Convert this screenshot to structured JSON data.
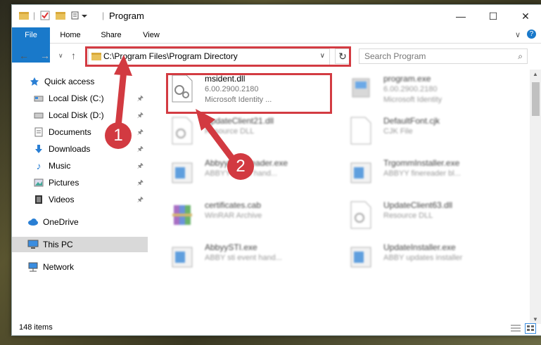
{
  "window": {
    "title": "Program"
  },
  "ribbon": {
    "tabs": [
      "File",
      "Home",
      "Share",
      "View"
    ]
  },
  "address": {
    "path": "C:\\Program Files\\Program Directory"
  },
  "search": {
    "placeholder": "Search Program"
  },
  "sidebar": {
    "items": [
      {
        "label": "Quick access",
        "icon": "star-icon"
      },
      {
        "label": "Local Disk (C:)",
        "icon": "drive-icon",
        "pinned": true
      },
      {
        "label": "Local Disk (D:)",
        "icon": "drive-icon",
        "pinned": true
      },
      {
        "label": "Documents",
        "icon": "documents-icon",
        "pinned": true
      },
      {
        "label": "Downloads",
        "icon": "download-icon",
        "pinned": true
      },
      {
        "label": "Music",
        "icon": "music-icon",
        "pinned": true
      },
      {
        "label": "Pictures",
        "icon": "pictures-icon",
        "pinned": true
      },
      {
        "label": "Videos",
        "icon": "videos-icon",
        "pinned": true
      },
      {
        "label": "OneDrive",
        "icon": "cloud-icon"
      },
      {
        "label": "This PC",
        "icon": "computer-icon",
        "selected": true
      },
      {
        "label": "Network",
        "icon": "network-icon"
      }
    ]
  },
  "files": [
    {
      "name": "msident.dll",
      "line1": "6.00.2900.2180",
      "line2": "Microsoft Identity ...",
      "icon": "dll-icon"
    },
    {
      "name": "program.exe",
      "line1": "6.00.2900.2180",
      "line2": "Microsoft Identity",
      "icon": "exe-icon"
    },
    {
      "name": "UpdateClient21.dll",
      "line1": "Resource DLL",
      "icon": "dll-icon"
    },
    {
      "name": "DefaultFont.cjk",
      "line1": "CJK File",
      "icon": "file-icon"
    },
    {
      "name": "AbbyyFineReader.exe",
      "line1": "ABBYY event hand...",
      "icon": "app-icon"
    },
    {
      "name": "TrgommInstaller.exe",
      "line1": "ABBYY finereader bl...",
      "icon": "app-icon"
    },
    {
      "name": "certificates.cab",
      "line1": "WinRAR Archive",
      "icon": "archive-icon"
    },
    {
      "name": "UpdateClient63.dll",
      "line1": "Resource DLL",
      "icon": "dll-icon"
    },
    {
      "name": "AbbyySTI.exe",
      "line1": "ABBY sti event hand...",
      "icon": "app-icon"
    },
    {
      "name": "UpdateInstaller.exe",
      "line1": "ABBY updates installer",
      "icon": "app-icon"
    }
  ],
  "status": {
    "count": "148 items"
  },
  "callouts": [
    "1",
    "2"
  ],
  "colors": {
    "accent": "#1979ca",
    "highlight": "#d33b42",
    "folder": "#e8c15a"
  }
}
